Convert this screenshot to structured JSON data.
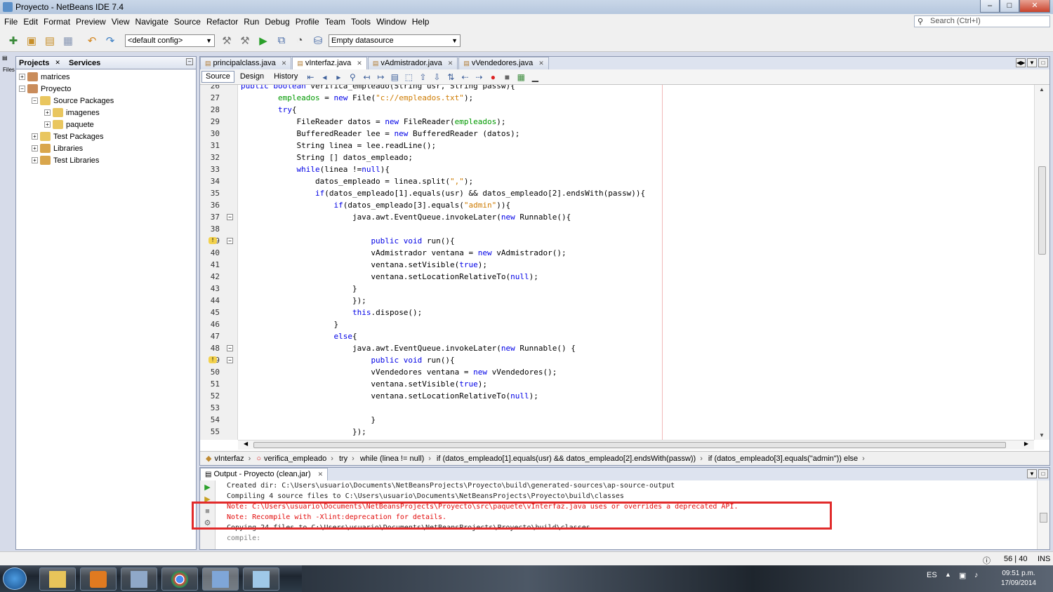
{
  "window": {
    "title": "Proyecto - NetBeans IDE 7.4"
  },
  "menu": [
    "File",
    "Edit",
    "Format",
    "Preview",
    "View",
    "Navigate",
    "Source",
    "Refactor",
    "Run",
    "Debug",
    "Profile",
    "Team",
    "Tools",
    "Window",
    "Help"
  ],
  "search": {
    "placeholder": "Search (Ctrl+I)"
  },
  "toolbar": {
    "config": "<default config>",
    "datasource": "Empty datasource"
  },
  "projects_panel": {
    "tabs": [
      "Projects",
      "Services"
    ],
    "tree": [
      {
        "label": "matrices",
        "level": 0,
        "icon": "project-cup-icon",
        "expander": "+"
      },
      {
        "label": "Proyecto",
        "level": 0,
        "icon": "project-cup-icon",
        "expander": "−"
      },
      {
        "label": "Source Packages",
        "level": 1,
        "icon": "package-folder-icon",
        "expander": "−"
      },
      {
        "label": "imagenes",
        "level": 2,
        "icon": "package-icon",
        "expander": "+"
      },
      {
        "label": "paquete",
        "level": 2,
        "icon": "package-icon",
        "expander": "+"
      },
      {
        "label": "Test Packages",
        "level": 1,
        "icon": "package-folder-icon",
        "expander": "+"
      },
      {
        "label": "Libraries",
        "level": 1,
        "icon": "library-icon",
        "expander": "+"
      },
      {
        "label": "Test Libraries",
        "level": 1,
        "icon": "library-icon",
        "expander": "+"
      }
    ]
  },
  "editor": {
    "tabs": [
      "principalclass.java",
      "vInterfaz.java",
      "vAdmistrador.java",
      "vVendedores.java"
    ],
    "active_tab": 1,
    "views": [
      "Source",
      "Design",
      "History"
    ],
    "lines": [
      {
        "n": "26",
        "fold": "",
        "hint": false,
        "segs": [
          [
            "k",
            "public boolean "
          ],
          [
            "t",
            "verifica_empleado(String usr, String passw){"
          ]
        ]
      },
      {
        "n": "27",
        "fold": "",
        "hint": false,
        "segs": [
          [
            "t",
            "        "
          ],
          [
            "f",
            "empleados"
          ],
          [
            "t",
            " = "
          ],
          [
            "k",
            "new "
          ],
          [
            "t",
            "File("
          ],
          [
            "s",
            "\"c://empleados.txt\""
          ],
          [
            "t",
            ");"
          ]
        ]
      },
      {
        "n": "28",
        "fold": "",
        "hint": false,
        "segs": [
          [
            "t",
            "        "
          ],
          [
            "k",
            "try"
          ],
          [
            "t",
            "{"
          ]
        ]
      },
      {
        "n": "29",
        "fold": "",
        "hint": false,
        "segs": [
          [
            "t",
            "            FileReader datos = "
          ],
          [
            "k",
            "new "
          ],
          [
            "t",
            "FileReader("
          ],
          [
            "f",
            "empleados"
          ],
          [
            "t",
            ");"
          ]
        ]
      },
      {
        "n": "30",
        "fold": "",
        "hint": false,
        "segs": [
          [
            "t",
            "            BufferedReader lee = "
          ],
          [
            "k",
            "new "
          ],
          [
            "t",
            "BufferedReader (datos);"
          ]
        ]
      },
      {
        "n": "31",
        "fold": "",
        "hint": false,
        "segs": [
          [
            "t",
            "            String linea = lee.readLine();"
          ]
        ]
      },
      {
        "n": "32",
        "fold": "",
        "hint": false,
        "segs": [
          [
            "t",
            "            String [] datos_empleado;"
          ]
        ]
      },
      {
        "n": "33",
        "fold": "",
        "hint": false,
        "segs": [
          [
            "t",
            "            "
          ],
          [
            "k",
            "while"
          ],
          [
            "t",
            "(linea !="
          ],
          [
            "k",
            "null"
          ],
          [
            "t",
            "){"
          ]
        ]
      },
      {
        "n": "34",
        "fold": "",
        "hint": false,
        "segs": [
          [
            "t",
            "                datos_empleado = linea.split("
          ],
          [
            "s",
            "\",\""
          ],
          [
            "t",
            ");"
          ]
        ]
      },
      {
        "n": "35",
        "fold": "",
        "hint": false,
        "segs": [
          [
            "t",
            "                "
          ],
          [
            "k",
            "if"
          ],
          [
            "t",
            "(datos_empleado[1].equals(usr) && datos_empleado[2].endsWith(passw)){"
          ]
        ]
      },
      {
        "n": "36",
        "fold": "",
        "hint": false,
        "segs": [
          [
            "t",
            "                    "
          ],
          [
            "k",
            "if"
          ],
          [
            "t",
            "(datos_empleado[3].equals("
          ],
          [
            "s",
            "\"admin\""
          ],
          [
            "t",
            ")){"
          ]
        ]
      },
      {
        "n": "37",
        "fold": "−",
        "hint": false,
        "segs": [
          [
            "t",
            "                        java.awt.EventQueue.invokeLater("
          ],
          [
            "k",
            "new "
          ],
          [
            "t",
            "Runnable(){"
          ]
        ]
      },
      {
        "n": "38",
        "fold": "",
        "hint": false,
        "segs": [
          [
            "t",
            ""
          ]
        ]
      },
      {
        "n": "39",
        "fold": "−",
        "hint": true,
        "segs": [
          [
            "t",
            "                            "
          ],
          [
            "k",
            "public void "
          ],
          [
            "t",
            "run(){"
          ]
        ]
      },
      {
        "n": "40",
        "fold": "",
        "hint": false,
        "segs": [
          [
            "t",
            "                            vAdmistrador ventana = "
          ],
          [
            "k",
            "new "
          ],
          [
            "t",
            "vAdmistrador();"
          ]
        ]
      },
      {
        "n": "41",
        "fold": "",
        "hint": false,
        "segs": [
          [
            "t",
            "                            ventana.setVisible("
          ],
          [
            "k",
            "true"
          ],
          [
            "t",
            ");"
          ]
        ]
      },
      {
        "n": "42",
        "fold": "",
        "hint": false,
        "segs": [
          [
            "t",
            "                            ventana.setLocationRelativeTo("
          ],
          [
            "k",
            "null"
          ],
          [
            "t",
            ");"
          ]
        ]
      },
      {
        "n": "43",
        "fold": "",
        "hint": false,
        "segs": [
          [
            "t",
            "                        }"
          ]
        ]
      },
      {
        "n": "44",
        "fold": "",
        "hint": false,
        "segs": [
          [
            "t",
            "                        });"
          ]
        ]
      },
      {
        "n": "45",
        "fold": "",
        "hint": false,
        "segs": [
          [
            "t",
            "                        "
          ],
          [
            "k",
            "this"
          ],
          [
            "t",
            ".dispose();"
          ]
        ]
      },
      {
        "n": "46",
        "fold": "",
        "hint": false,
        "segs": [
          [
            "t",
            "                    }"
          ]
        ]
      },
      {
        "n": "47",
        "fold": "",
        "hint": false,
        "segs": [
          [
            "t",
            "                    "
          ],
          [
            "k",
            "else"
          ],
          [
            "t",
            "{"
          ]
        ]
      },
      {
        "n": "48",
        "fold": "−",
        "hint": false,
        "segs": [
          [
            "t",
            "                        java.awt.EventQueue.invokeLater("
          ],
          [
            "k",
            "new "
          ],
          [
            "t",
            "Runnable() {"
          ]
        ]
      },
      {
        "n": "49",
        "fold": "−",
        "hint": true,
        "segs": [
          [
            "t",
            "                            "
          ],
          [
            "k",
            "public void "
          ],
          [
            "t",
            "run(){"
          ]
        ]
      },
      {
        "n": "50",
        "fold": "",
        "hint": false,
        "segs": [
          [
            "t",
            "                            vVendedores ventana = "
          ],
          [
            "k",
            "new "
          ],
          [
            "t",
            "vVendedores();"
          ]
        ]
      },
      {
        "n": "51",
        "fold": "",
        "hint": false,
        "segs": [
          [
            "t",
            "                            ventana.setVisible("
          ],
          [
            "k",
            "true"
          ],
          [
            "t",
            ");"
          ]
        ]
      },
      {
        "n": "52",
        "fold": "",
        "hint": false,
        "segs": [
          [
            "t",
            "                            ventana.setLocationRelativeTo("
          ],
          [
            "k",
            "null"
          ],
          [
            "t",
            ");"
          ]
        ]
      },
      {
        "n": "53",
        "fold": "",
        "hint": false,
        "segs": [
          [
            "t",
            ""
          ]
        ]
      },
      {
        "n": "54",
        "fold": "",
        "hint": false,
        "segs": [
          [
            "t",
            "                            }"
          ]
        ]
      },
      {
        "n": "55",
        "fold": "",
        "hint": false,
        "segs": [
          [
            "t",
            "                        });"
          ]
        ]
      }
    ],
    "breadcrumbs": [
      "vInterfaz",
      "verifica_empleado",
      "try",
      "while (linea != null)",
      "if (datos_empleado[1].equals(usr) && datos_empleado[2].endsWith(passw))",
      "if (datos_empleado[3].equals(\"admin\")) else"
    ]
  },
  "output": {
    "tab": "Output - Proyecto (clean,jar)",
    "lines": [
      {
        "text": "Created dir: C:\\Users\\usuario\\Documents\\NetBeansProjects\\Proyecto\\build\\generated-sources\\ap-source-output",
        "cls": ""
      },
      {
        "text": "Compiling 4 source files to C:\\Users\\usuario\\Documents\\NetBeansProjects\\Proyecto\\build\\classes",
        "cls": ""
      },
      {
        "text": "Note: C:\\Users\\usuario\\Documents\\NetBeansProjects\\Proyecto\\src\\paquete\\vInterfaz.java uses or overrides a deprecated API.",
        "cls": "err"
      },
      {
        "text": "Note: Recompile with -Xlint:deprecation for details.",
        "cls": "err"
      },
      {
        "text": "Copying 24 files to C:\\Users\\usuario\\Documents\\NetBeansProjects\\Proyecto\\build\\classes",
        "cls": ""
      },
      {
        "text": "compile:",
        "cls": "gray"
      }
    ]
  },
  "status": {
    "position": "56 | 40",
    "mode": "INS"
  },
  "taskbar": {
    "lang": "ES",
    "time": "09:51 p.m.",
    "date": "17/09/2014"
  }
}
